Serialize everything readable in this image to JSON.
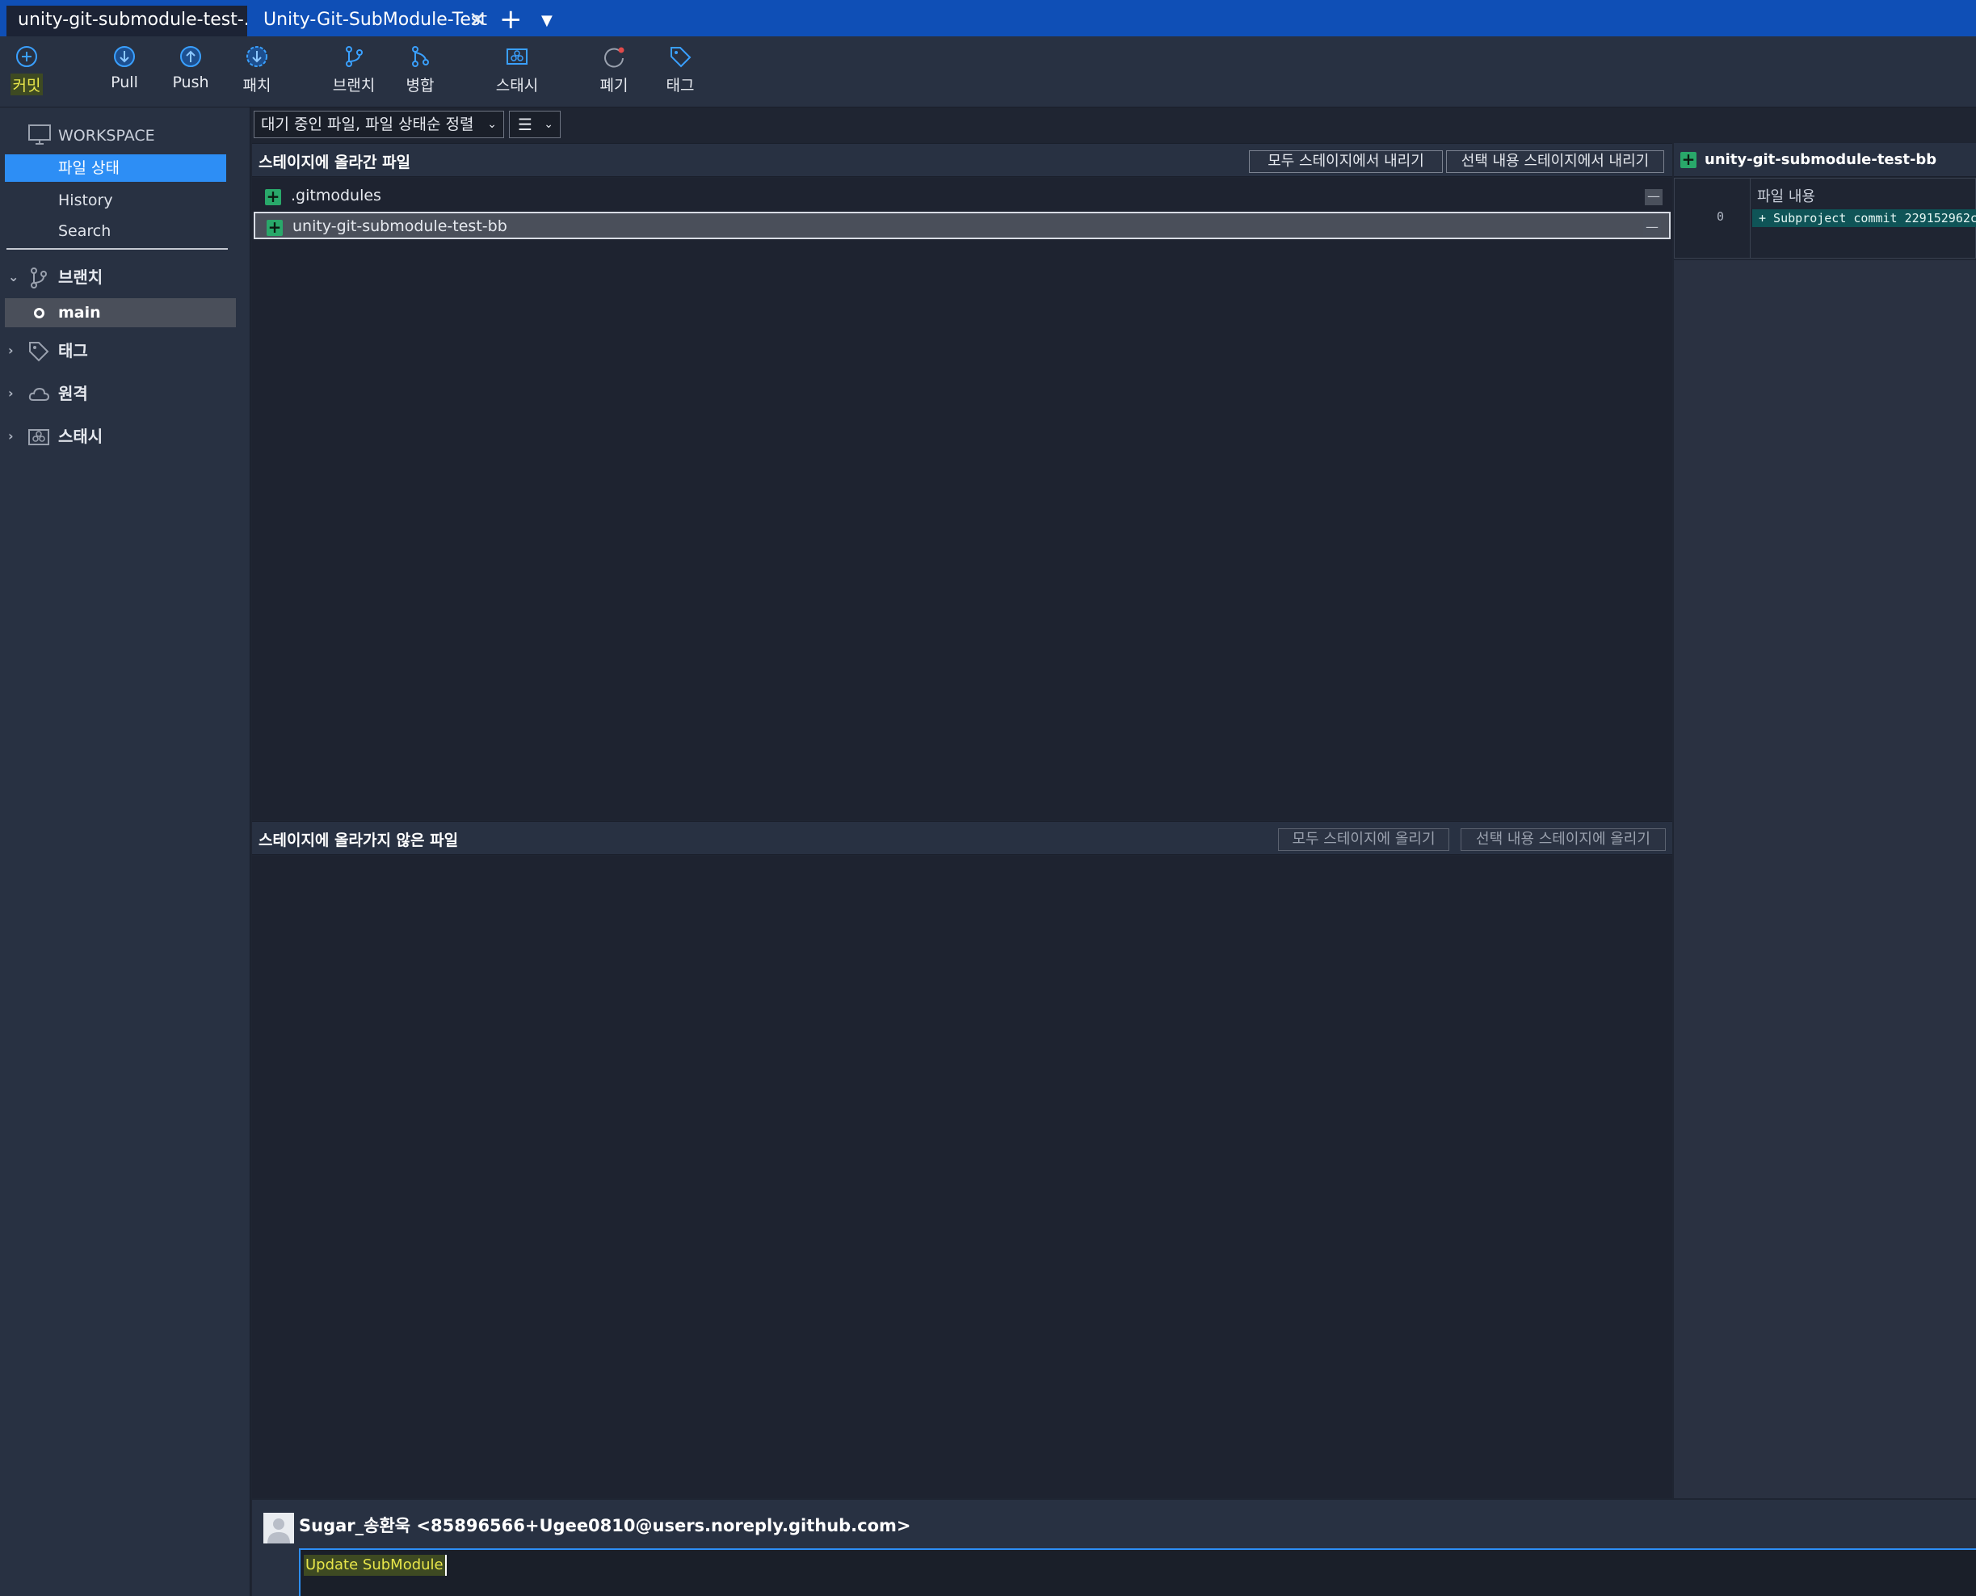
{
  "tabs": [
    {
      "label": "unity-git-submodule-test-..."
    },
    {
      "label": "Unity-Git-SubModule-Test"
    }
  ],
  "toolbar": {
    "commit": "커밋",
    "pull": "Pull",
    "push": "Push",
    "fetch": "패치",
    "branch": "브랜치",
    "merge": "병합",
    "stash": "스태시",
    "discard": "폐기",
    "tag": "태그"
  },
  "sidebar": {
    "workspace": "WORKSPACE",
    "file_status": "파일 상태",
    "history": "History",
    "search": "Search",
    "branches_label": "브랜치",
    "current_branch": "main",
    "tags_label": "태그",
    "remotes_label": "원격",
    "stashes_label": "스태시"
  },
  "filter": {
    "selected": "대기 중인 파일, 파일 상태순 정렬",
    "view_icon": "list-icon"
  },
  "staged": {
    "title": "스테이지에 올라간 파일",
    "unstage_all": "모두 스테이지에서 내리기",
    "unstage_selected": "선택 내용 스테이지에서 내리기",
    "files": [
      {
        "name": ".gitmodules",
        "status": "added"
      },
      {
        "name": "unity-git-submodule-test-bb",
        "status": "added"
      }
    ]
  },
  "unstaged": {
    "title": "스테이지에 올라가지 않은 파일",
    "stage_all": "모두 스테이지에 올리기",
    "stage_selected": "선택 내용 스테이지에 올리기"
  },
  "diff": {
    "file": "unity-git-submodule-test-bb",
    "hunk_title": "파일 내용",
    "line_number": "0",
    "added_line": "+ Subproject commit 229152962c"
  },
  "commit": {
    "author": "Sugar_송환욱 <85896566+Ugee0810@users.noreply.github.com>",
    "message": "Update SubModule"
  },
  "colors": {
    "tabbar": "#0f4fb6",
    "accent": "#2d8ef5",
    "added": "#29a86a",
    "highlight_text": "#e8e64a"
  }
}
